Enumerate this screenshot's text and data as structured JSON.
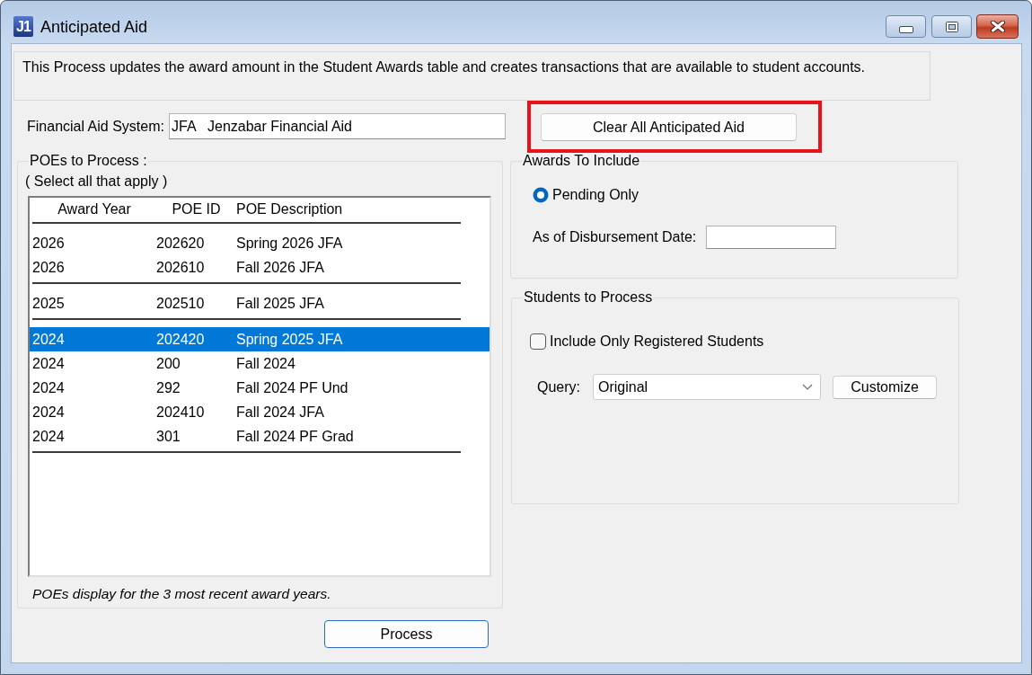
{
  "window": {
    "title": "Anticipated Aid",
    "logo_text": "J1"
  },
  "description": "This Process updates the award amount in the Student Awards table and creates transactions that are available to student accounts.",
  "financial_aid_system": {
    "label": "Financial Aid System:",
    "value": "JFA   Jenzabar Financial Aid"
  },
  "clear_button": {
    "label": "Clear All Anticipated Aid",
    "highlighted": true
  },
  "poes": {
    "legend": "POEs to Process :",
    "hint": "( Select all that apply )",
    "columns": [
      "Award Year",
      "POE ID",
      "POE Description"
    ],
    "groups": [
      {
        "rows": [
          {
            "award_year": "2026",
            "poe_id": "202620",
            "description": "Spring 2026 JFA",
            "selected": false
          },
          {
            "award_year": "2026",
            "poe_id": "202610",
            "description": "Fall 2026 JFA",
            "selected": false
          }
        ]
      },
      {
        "rows": [
          {
            "award_year": "2025",
            "poe_id": "202510",
            "description": "Fall 2025 JFA",
            "selected": false
          }
        ]
      },
      {
        "rows": [
          {
            "award_year": "2024",
            "poe_id": "202420",
            "description": "Spring 2025 JFA",
            "selected": true
          },
          {
            "award_year": "2024",
            "poe_id": "200",
            "description": "Fall 2024",
            "selected": false
          },
          {
            "award_year": "2024",
            "poe_id": "292",
            "description": "Fall 2024 PF Und",
            "selected": false
          },
          {
            "award_year": "2024",
            "poe_id": "202410",
            "description": "Fall 2024 JFA",
            "selected": false
          },
          {
            "award_year": "2024",
            "poe_id": "301",
            "description": "Fall 2024 PF Grad",
            "selected": false
          }
        ]
      }
    ],
    "footnote": "POEs display for the 3 most recent award years."
  },
  "process_button": {
    "label": "Process",
    "default": true
  },
  "awards_to_include": {
    "legend": "Awards To Include",
    "options": [
      {
        "label": "Pending Only",
        "selected": true
      }
    ],
    "date_label": "As of Disbursement Date:"
  },
  "students_to_process": {
    "legend": "Students to Process",
    "checkbox": {
      "label": "Include Only Registered Students",
      "checked": false
    },
    "query_label": "Query:",
    "query_value": "Original",
    "customize_button": "Customize"
  }
}
